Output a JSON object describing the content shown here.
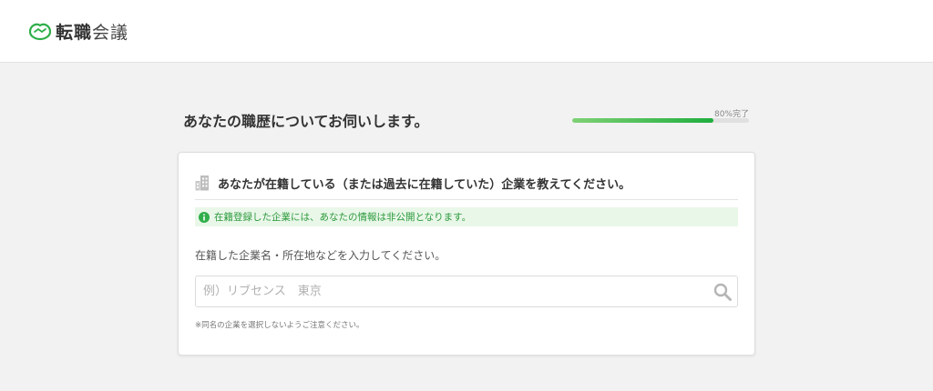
{
  "header": {
    "logo_bold": "転職",
    "logo_light": "会議",
    "logo_icon": "handshake-icon",
    "accent": "#2fae4a"
  },
  "main": {
    "title": "あなたの職歴についてお伺いします。",
    "progress": {
      "label": "80%完了",
      "value": 0.8,
      "color": "#1fae3f"
    }
  },
  "card": {
    "icon": "building-icon",
    "title": "あなたが在籍している（または過去に在籍していた）企業を教えてください。",
    "notice": {
      "icon": "info-icon",
      "text": "在籍登録した企業には、あなたの情報は非公開となります。",
      "color": "#2c9a3c",
      "background": "#e9f7e9"
    },
    "input_label": "在籍した企業名・所在地などを入力してください。",
    "search": {
      "placeholder": "例）リブセンス　東京",
      "value": "",
      "icon": "search-icon"
    },
    "note": "※同名の企業を選択しないようご注意ください。"
  }
}
